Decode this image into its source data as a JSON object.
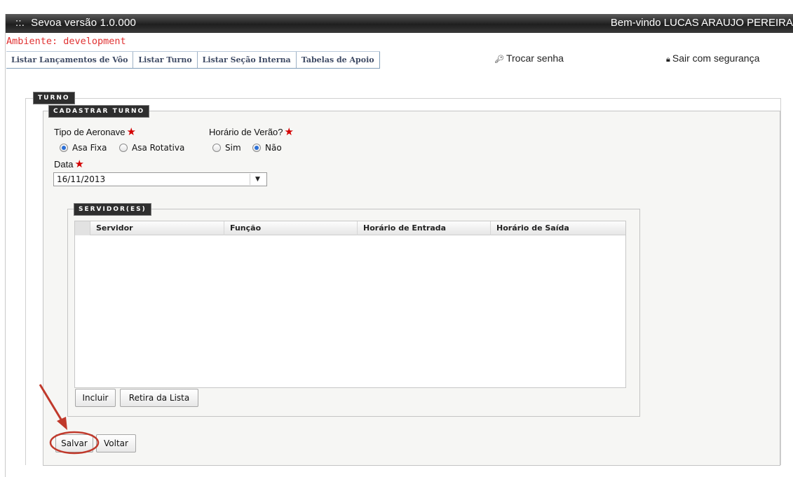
{
  "header": {
    "prefix": "::.",
    "app_title": "Sevoa versão 1.0.000",
    "welcome": "Bem-vindo LUCAS ARAUJO PEREIRA"
  },
  "environment": "Ambiente: development",
  "menu": {
    "items": [
      {
        "label": "Listar Lançamentos de Vôo"
      },
      {
        "label": "Listar Turno"
      },
      {
        "label": "Listar Seção Interna"
      },
      {
        "label": "Tabelas de Apoio"
      }
    ],
    "change_password": "Trocar senha",
    "logout": "Sair com segurança"
  },
  "form": {
    "legend_outer": "TURNO",
    "legend_inner": "CADASTRAR TURNO",
    "aircraft_type": {
      "label": "Tipo de Aeronave",
      "options": [
        "Asa Fixa",
        "Asa Rotativa"
      ],
      "selected": "Asa Fixa"
    },
    "summer_time": {
      "label": "Horário de Verão?",
      "options": [
        "Sim",
        "Não"
      ],
      "selected": "Não"
    },
    "date": {
      "label": "Data",
      "value": "16/11/2013"
    },
    "servers": {
      "legend": "SERVIDOR(ES)",
      "columns": [
        "Servidor",
        "Função",
        "Horário de Entrada",
        "Horário de Saída"
      ],
      "rows": [],
      "add_button": "Incluir",
      "remove_button": "Retira da Lista"
    },
    "save_button": "Salvar",
    "back_button": "Voltar"
  },
  "colors": {
    "environment_text": "#e03030",
    "required_star": "#d40000",
    "annotation": "#c0392b"
  }
}
